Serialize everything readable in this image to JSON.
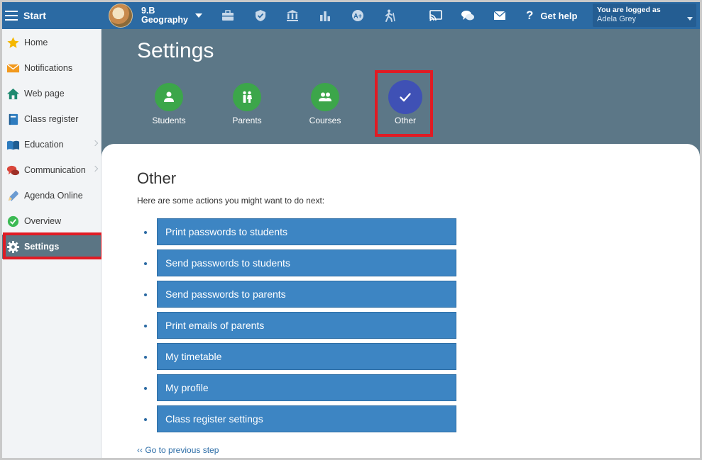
{
  "topbar": {
    "start_label": "Start",
    "class_line1": "9.B",
    "class_line2": "Geography",
    "help_label": "Get help",
    "user_line1": "You are logged as",
    "user_line2": "Adela Grey"
  },
  "sidebar": {
    "items": [
      {
        "label": "Home",
        "icon": "star-icon"
      },
      {
        "label": "Notifications",
        "icon": "envelope-icon"
      },
      {
        "label": "Web page",
        "icon": "house-icon"
      },
      {
        "label": "Class register",
        "icon": "book-icon"
      },
      {
        "label": "Education",
        "icon": "open-book-icon"
      },
      {
        "label": "Communication",
        "icon": "chat-bubbles-icon"
      },
      {
        "label": "Agenda Online",
        "icon": "pencil-icon"
      },
      {
        "label": "Overview",
        "icon": "check-circle-icon"
      },
      {
        "label": "Settings",
        "icon": "gear-icon"
      }
    ]
  },
  "settings": {
    "title": "Settings",
    "categories": [
      {
        "label": "Students",
        "icon": "person-icon"
      },
      {
        "label": "Parents",
        "icon": "two-people-icon"
      },
      {
        "label": "Courses",
        "icon": "group-icon"
      },
      {
        "label": "Other",
        "icon": "checkmark-icon"
      }
    ]
  },
  "content": {
    "heading": "Other",
    "intro": "Here are some actions you might want to do next:",
    "actions": [
      "Print passwords to students",
      "Send passwords to students",
      "Send passwords to parents",
      "Print emails of parents",
      "My timetable",
      "My profile",
      "Class register settings"
    ],
    "prev_link": "‹‹ Go to previous step"
  },
  "colors": {
    "topbar": "#2b6aa3",
    "header_bg": "#5c7787",
    "category_green": "#3ca64a",
    "category_selected": "#3f51b5",
    "action_button": "#3d85c3",
    "highlight_red": "#e01b24"
  }
}
